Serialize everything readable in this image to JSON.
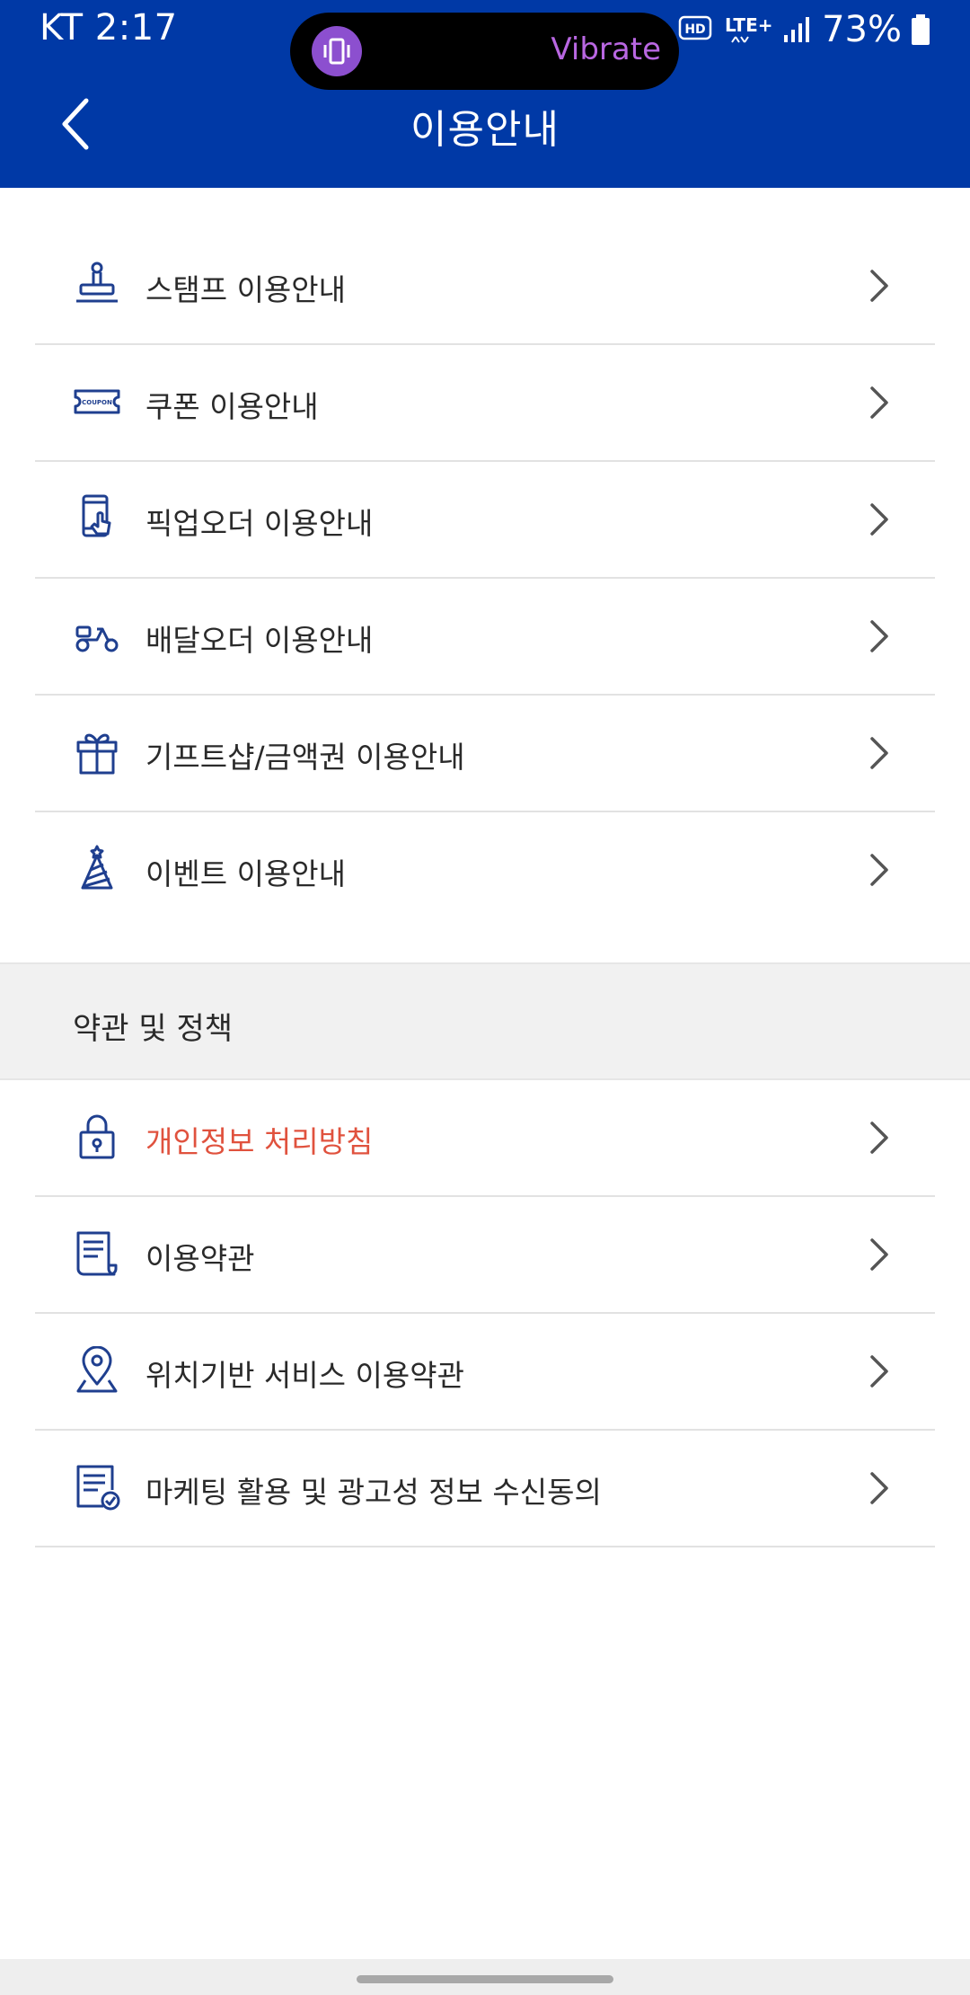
{
  "status_bar": {
    "carrier_time": "KT 2:17",
    "hd": "HD",
    "network": "LTE+",
    "battery": "73%"
  },
  "pill": {
    "label": "Vibrate",
    "icon": "vibrate-icon"
  },
  "header": {
    "title": "이용안내",
    "back_icon": "chevron-left-icon"
  },
  "colors": {
    "header_bg": "#0039A6",
    "icon_blue": "#1F3F8F",
    "highlight": "#E0523E"
  },
  "guide_items": [
    {
      "label": "스탬프 이용안내",
      "icon": "stamp-icon"
    },
    {
      "label": "쿠폰 이용안내",
      "icon": "coupon-icon",
      "icon_text": "COUPON"
    },
    {
      "label": "픽업오더 이용안내",
      "icon": "phone-tap-icon"
    },
    {
      "label": "배달오더 이용안내",
      "icon": "scooter-icon"
    },
    {
      "label": "기프트샵/금액권 이용안내",
      "icon": "gift-icon"
    },
    {
      "label": "이벤트 이용안내",
      "icon": "party-hat-icon"
    }
  ],
  "policy_section": {
    "title": "약관 및 정책",
    "items": [
      {
        "label": "개인정보 처리방침",
        "icon": "lock-icon",
        "highlight": true
      },
      {
        "label": "이용약관",
        "icon": "document-icon"
      },
      {
        "label": "위치기반 서비스 이용약관",
        "icon": "location-pin-icon"
      },
      {
        "label": "마케팅 활용 및 광고성 정보 수신동의",
        "icon": "checklist-icon"
      }
    ]
  }
}
